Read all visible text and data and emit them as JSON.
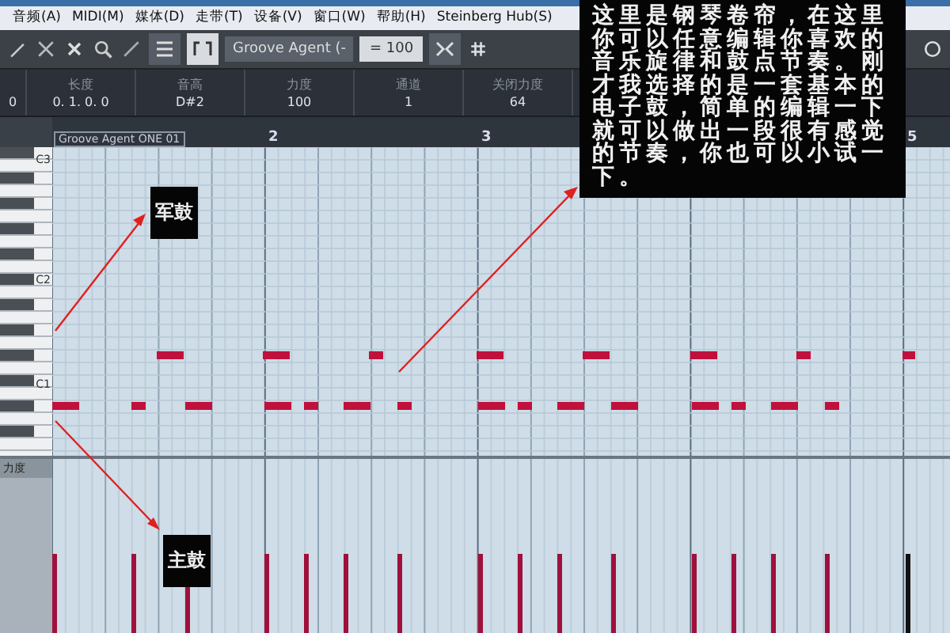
{
  "menu": [
    "音频(A)",
    "MIDI(M)",
    "媒体(D)",
    "走带(T)",
    "设备(V)",
    "窗口(W)",
    "帮助(H)",
    "Steinberg Hub(S)"
  ],
  "toolbar": {
    "instrument": "Groove Agent (-",
    "tempo": "= 100"
  },
  "info_line": [
    {
      "value": "0"
    },
    {
      "label": "长度",
      "value": "0. 1. 0. 0"
    },
    {
      "label": "音高",
      "value": "D#2"
    },
    {
      "label": "力度",
      "value": "100"
    },
    {
      "label": "通道",
      "value": "1"
    },
    {
      "label": "关闭力度",
      "value": "64"
    }
  ],
  "ruler": {
    "part_name": "Groove Agent ONE 01",
    "labels": [
      "2",
      "3",
      "5"
    ]
  },
  "keyboard_labels": [
    "C3",
    "C2",
    "C1"
  ],
  "controller_lane": {
    "label": "力度"
  },
  "callouts": [
    {
      "kind": "note",
      "text": "这里是钢琴卷帘，在这里你可以任意编辑你喜欢的音乐旋律和鼓点节奏。刚才我选择的是一套基本的电子鼓，简单的编辑一下就可以做出一段很有感觉的节奏，你也可以小试一下。"
    },
    {
      "kind": "tag",
      "text": "军鼓"
    },
    {
      "kind": "tag",
      "text": "主鼓"
    }
  ]
}
